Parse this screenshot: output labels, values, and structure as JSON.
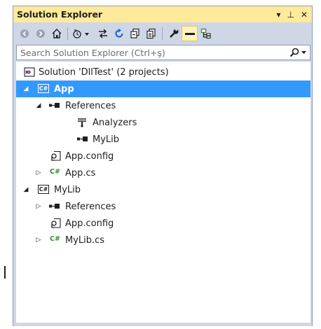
{
  "window": {
    "title": "Solution Explorer",
    "controls": {
      "dropdown": "▾",
      "pin": "⊥",
      "close": "✕"
    }
  },
  "toolbar": {
    "buttons": [
      "back",
      "forward",
      "home",
      "pending-changes-filter",
      "sync-with-active-document",
      "refresh",
      "collapse-all",
      "show-all-files",
      "properties",
      "preview-selected",
      "class-view"
    ]
  },
  "search": {
    "placeholder": "Search Solution Explorer (Ctrl+ş)",
    "icon": "search-icon"
  },
  "tree": {
    "solution": "Solution 'DllTest' (2 projects)",
    "app_project": "App",
    "app_references": "References",
    "app_analyzers": "Analyzers",
    "app_mylib_ref": "MyLib",
    "app_config": "App.config",
    "app_cs": "App.cs",
    "mylib_project": "MyLib",
    "mylib_references": "References",
    "mylib_config": "App.config",
    "mylib_cs": "MyLib.cs",
    "cs_badge": "C#",
    "proj_badge": "C#"
  },
  "colors": {
    "accent_selection": "#3399ff",
    "title_bar": "#ffe99a",
    "chrome": "#cfd6e5"
  }
}
